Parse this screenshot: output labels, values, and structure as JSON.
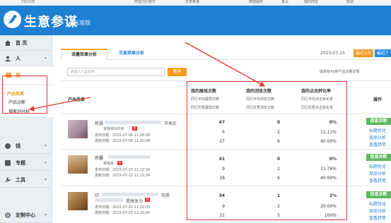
{
  "topbar": {
    "items": [
      "7月15日",
      "阿里巴巴官方",
      "生意参谋",
      "数据服务",
      "首页",
      "我的阿里",
      "帮助"
    ]
  },
  "header": {
    "brand": "生意参谋",
    "edition": "标准版"
  },
  "sidebar": {
    "items": [
      {
        "label": "首 页",
        "icon": "home-icon"
      },
      {
        "label": "人",
        "icon": "person-icon",
        "arrow": "▾"
      },
      {
        "label": "货",
        "icon": "goods-icon",
        "active": true
      },
      {
        "label": "钱",
        "icon": "money-icon",
        "arrow": "▾"
      },
      {
        "label": "专题",
        "icon": "topic-icon",
        "arrow": "▾"
      },
      {
        "label": "工具",
        "icon": "tool-icon",
        "arrow": "▾"
      },
      {
        "label": "定制中心",
        "icon": "custom-icon",
        "arrow": "▾"
      }
    ],
    "sub_items": [
      "产品效果",
      "产品诊断",
      "搜索词分析"
    ]
  },
  "tabs": {
    "active": "流量效果分析",
    "inactive": "交易效果分析"
  },
  "date": {
    "value": "2015-07-15",
    "btn_1": "最近1天",
    "btn_7": "最近7天"
  },
  "search": {
    "placeholder": "请输入产品名称",
    "button": "查询",
    "note": "提供有43条产品流量详情"
  },
  "table": {
    "headers": {
      "product": "产品信息",
      "exposure": "我的展现次数",
      "views": "我的浏览次数",
      "ctr": "我的点击转化率",
      "action": "操作"
    },
    "subheaders": {
      "exposure": [
        "同行平均展现次数",
        "同行优秀展现次数"
      ],
      "views": [
        "同行平均浏览次数",
        "同行优秀浏览次数"
      ],
      "ctr": [
        "同行平均点击转化率",
        "同行优秀点击转化率"
      ]
    },
    "rows": [
      {
        "title_a": "新疆",
        "title_b": "节地买",
        "shop": "家我来500克",
        "badge": "荐",
        "publish": "发布日期：2015-07-06 11:30:08",
        "update": "更新日期：2015-07-06 11:30:08",
        "exposure": [
          "47",
          "6",
          "27"
        ],
        "views": [
          "0",
          "2",
          "6"
        ],
        "ctr": [
          "0%",
          "11.11%",
          "40.00%"
        ],
        "actions": [
          "信息诊断",
          "标题优化",
          "竞品分析",
          "查看趋势"
        ]
      },
      {
        "title_a": "新疆 ",
        "title_b": "作",
        "shop": "家我来",
        "badge": "荐",
        "publish": "发布日期：2015-07-15 11:12:34",
        "update": "更新日期：2015-07-15 11:12:34",
        "exposure": [
          "41",
          "9",
          "28"
        ],
        "views": [
          "0",
          "2",
          "6"
        ],
        "ctr": [
          "0%",
          "11.76%",
          "40.00%"
        ],
        "actions": [
          "信息诊断",
          "标题优化",
          "竞品分析",
          "查看趋势"
        ]
      },
      {
        "title_a": "印",
        "title_b": "芙美 ",
        "title_c": "提高体力",
        "badge": "荐",
        "publish": "发布日期：2015-07-25 12:20:00",
        "update": "更新日期：2015-07-25 12:20:00",
        "exposure": [
          "34",
          "9",
          "21"
        ],
        "views": [
          "1",
          "2",
          "5"
        ],
        "ctr": [
          "2%",
          "20.00%",
          "100%"
        ],
        "actions": [
          "信息诊断",
          "标题优化",
          "竞品分析",
          "查看趋势"
        ]
      }
    ]
  },
  "colors": {
    "brand_blue": "#1e7fd3",
    "orange": "#f39b1f",
    "green": "#5cb85c",
    "annotation_red": "#e33"
  }
}
